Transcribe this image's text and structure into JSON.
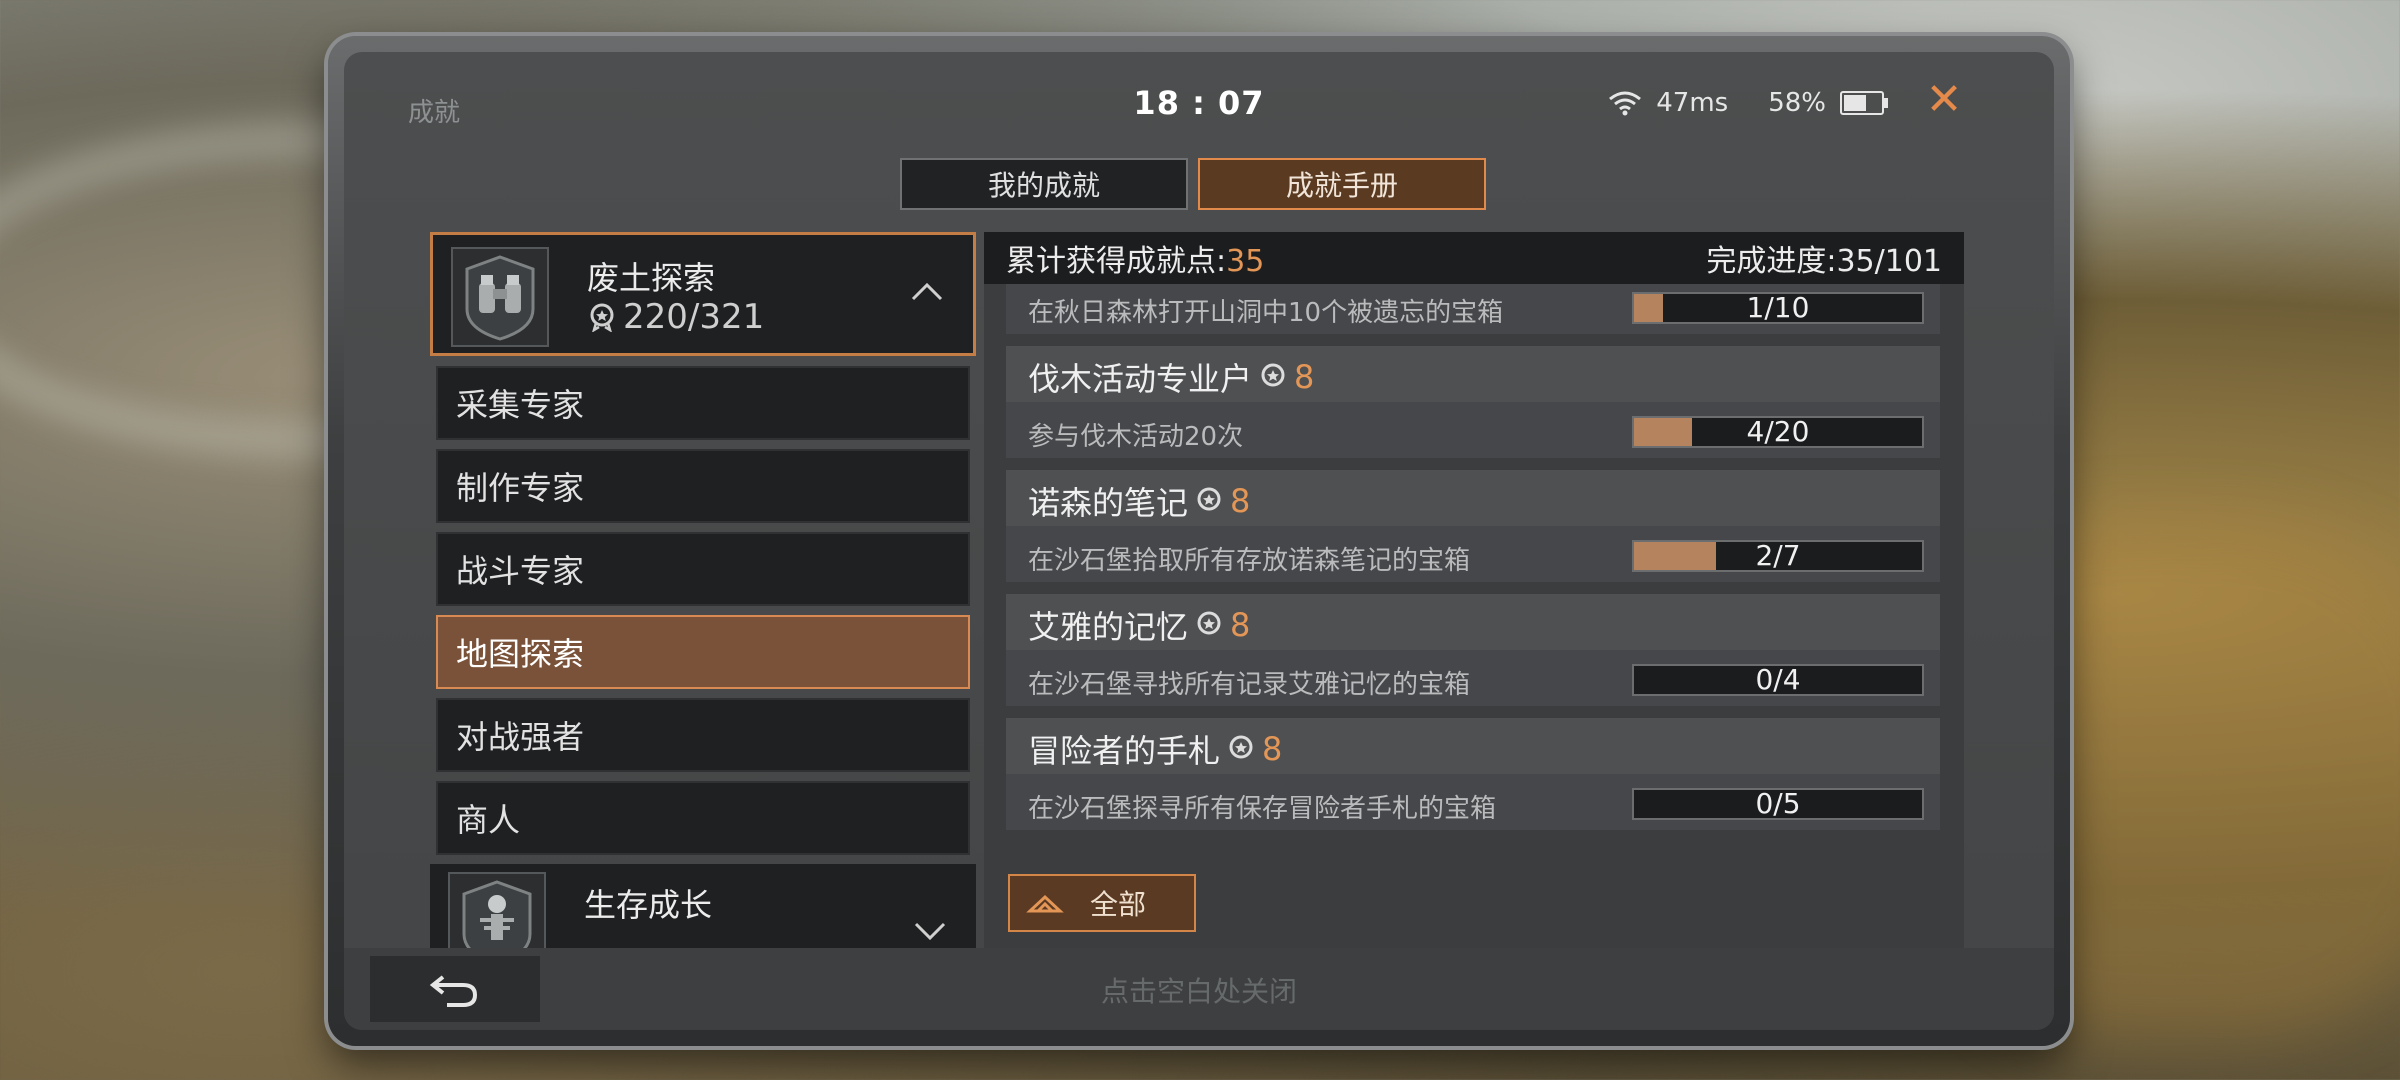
{
  "window": {
    "title": "成就"
  },
  "status": {
    "time": "18 : 07",
    "ping": "47ms",
    "battery": "58%"
  },
  "tabs": [
    {
      "label": "我的成就",
      "active": false
    },
    {
      "label": "成就手册",
      "active": true
    }
  ],
  "category": {
    "title": "废土探索",
    "score": "220/321",
    "items": [
      {
        "label": "采集专家"
      },
      {
        "label": "制作专家"
      },
      {
        "label": "战斗专家"
      },
      {
        "label": "地图探索",
        "active": true
      },
      {
        "label": "对战强者"
      },
      {
        "label": "商人"
      }
    ],
    "next": {
      "title": "生存成长"
    }
  },
  "summary": {
    "points_label": "累计获得成就点:",
    "points_value": "35",
    "progress_label": "完成进度:35/101"
  },
  "achievements": [
    {
      "name": "",
      "points": "",
      "desc": "在秋日森林打开山洞中10个被遗忘的宝箱",
      "progress": "1/10",
      "fraction": 0.1
    },
    {
      "name": "伐木活动专业户",
      "points": "8",
      "desc": "参与伐木活动20次",
      "progress": "4/20",
      "fraction": 0.2
    },
    {
      "name": "诺森的笔记",
      "points": "8",
      "desc": "在沙石堡拾取所有存放诺森笔记的宝箱",
      "progress": "2/7",
      "fraction": 0.2857
    },
    {
      "name": "艾雅的记忆",
      "points": "8",
      "desc": "在沙石堡寻找所有记录艾雅记忆的宝箱",
      "progress": "0/4",
      "fraction": 0
    },
    {
      "name": "冒险者的手札",
      "points": "8",
      "desc": "在沙石堡探寻所有保存冒险者手札的宝箱",
      "progress": "0/5",
      "fraction": 0
    }
  ],
  "all_button": {
    "label": "全部"
  },
  "bottom": {
    "hint": "点击空白处关闭"
  },
  "colors": {
    "accent": "#e39656",
    "tab_active_bg": "#5b3a22",
    "progress_fill": "#b6835f"
  },
  "icons": [
    "wifi-icon",
    "battery-icon",
    "close-icon",
    "medal-icon",
    "chevron-up-icon",
    "chevron-down-icon",
    "back-arrow-icon",
    "double-chevron-up-icon"
  ]
}
